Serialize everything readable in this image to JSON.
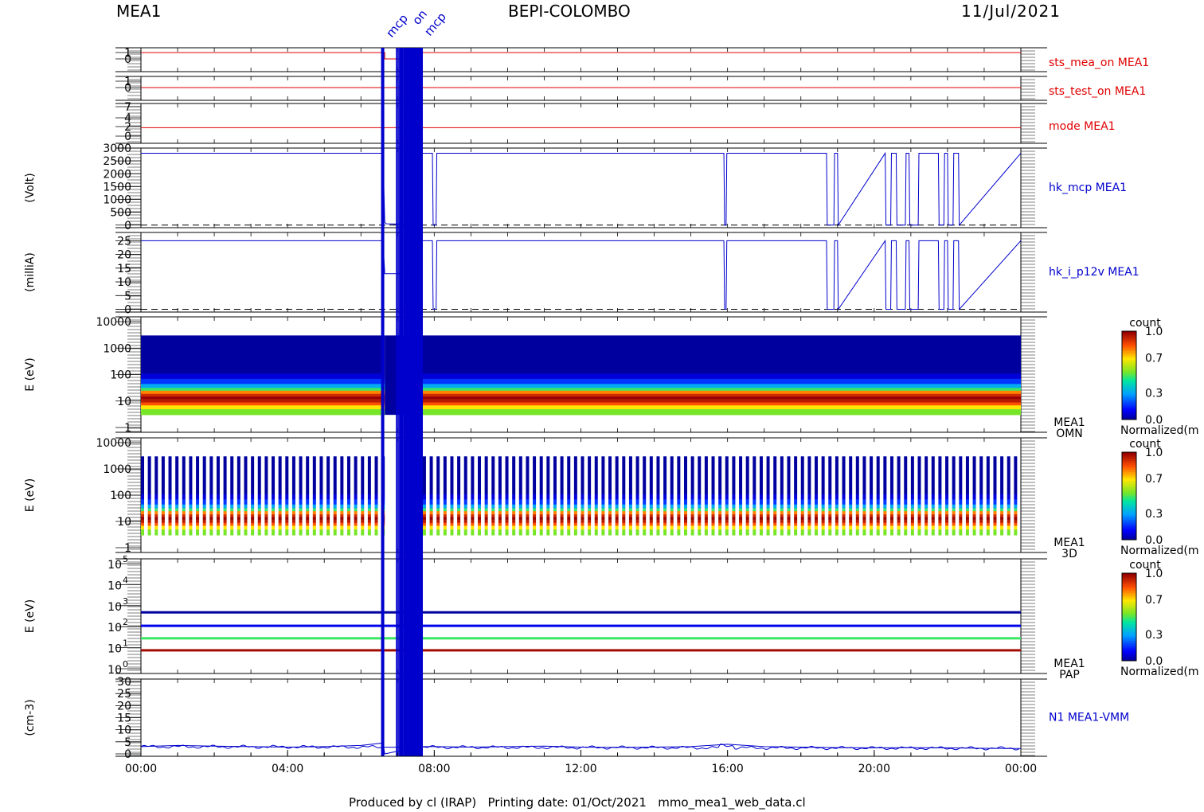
{
  "header": {
    "left": "MEA1",
    "center": "BEPI-COLOMBO",
    "right": "11/Jul/2021"
  },
  "footer": {
    "text": "Produced by cl (IRAP)   Printing date: 01/Oct/2021   mmo_mea1_web_data.cl"
  },
  "event_markers": {
    "labels": [
      "mcp",
      "on",
      "mcp"
    ],
    "color": "#0000cc"
  },
  "colors": {
    "red": "#e00000",
    "blue": "#0000cc",
    "black": "#000000"
  },
  "chart_data": [
    {
      "id": "sts_mea_on",
      "type": "line",
      "title": "sts_mea_on MEA1",
      "ylabel": "",
      "yticks": [
        "1",
        "0"
      ],
      "ylim": [
        0,
        1
      ],
      "color": "#e00000",
      "x_hours": [
        0,
        6.65,
        6.65,
        7.2,
        7.2,
        24
      ],
      "values": [
        1,
        1,
        0,
        0,
        1,
        1
      ]
    },
    {
      "id": "sts_test_on",
      "type": "line",
      "title": "sts_test_on MEA1",
      "ylabel": "",
      "yticks": [
        "1",
        "0"
      ],
      "ylim": [
        0,
        1
      ],
      "color": "#e00000",
      "x_hours": [
        0,
        24
      ],
      "values": [
        0,
        0
      ]
    },
    {
      "id": "mode",
      "type": "line",
      "title": "mode MEA1",
      "ylabel": "",
      "yticks": [
        "7",
        "4",
        "2",
        "0"
      ],
      "ylim": [
        0,
        7
      ],
      "color": "#e00000",
      "x_hours": [
        0,
        24
      ],
      "values": [
        2,
        2
      ]
    },
    {
      "id": "hk_mcp",
      "type": "line",
      "title": "hk_mcp MEA1",
      "ylabel": "(Volt)",
      "yticks": [
        "3000",
        "2500",
        "2000",
        "1500",
        "1000",
        "500",
        "0"
      ],
      "ylim": [
        -100,
        3000
      ],
      "color": "#0000cc",
      "baseline": 2800,
      "x_hours": [
        0,
        6.6,
        6.65,
        6.7,
        7.2,
        7.6,
        7.95,
        7.97,
        8.05,
        8.07,
        15.9,
        15.92,
        15.96,
        15.98,
        18.7,
        18.72,
        18.9,
        18.92,
        19.0,
        19.02,
        20.3,
        20.32,
        20.45,
        20.47,
        20.6,
        20.62,
        20.85,
        20.87,
        20.95,
        20.97,
        21.2,
        21.22,
        21.75,
        21.77,
        21.9,
        21.92,
        22.0,
        22.02,
        22.15,
        22.17,
        22.3,
        22.32,
        24
      ],
      "values": [
        2800,
        2800,
        100,
        50,
        30,
        2800,
        2800,
        0,
        0,
        2800,
        2800,
        0,
        0,
        2800,
        2800,
        0,
        0,
        2800,
        2800,
        0,
        2800,
        0,
        0,
        2800,
        2800,
        0,
        0,
        2800,
        2800,
        0,
        0,
        2800,
        2800,
        0,
        0,
        2800,
        2800,
        0,
        0,
        2800,
        2800,
        0,
        2800
      ]
    },
    {
      "id": "hk_i_p12v",
      "type": "line",
      "title": "hk_i_p12v MEA1",
      "ylabel": "(milliA)",
      "yticks": [
        "25",
        "20",
        "15",
        "10",
        "5",
        "0"
      ],
      "ylim": [
        -1,
        28
      ],
      "color": "#0000cc",
      "baseline": 25,
      "x_hours": [
        0,
        6.6,
        6.65,
        7.2,
        7.6,
        7.95,
        7.97,
        8.05,
        8.07,
        15.9,
        15.92,
        15.96,
        15.98,
        18.7,
        18.72,
        18.9,
        18.92,
        19.0,
        19.02,
        20.3,
        20.32,
        20.45,
        20.47,
        20.6,
        20.62,
        20.85,
        20.87,
        20.95,
        20.97,
        21.2,
        21.22,
        21.75,
        21.77,
        21.9,
        21.92,
        22.0,
        22.02,
        22.15,
        22.17,
        22.3,
        22.32,
        24
      ],
      "values": [
        25,
        25,
        13,
        13,
        25,
        25,
        0,
        0,
        25,
        25,
        0,
        0,
        25,
        25,
        0,
        0,
        25,
        25,
        0,
        25,
        0,
        0,
        25,
        25,
        0,
        0,
        25,
        25,
        0,
        0,
        25,
        25,
        0,
        0,
        25,
        25,
        0,
        0,
        25,
        25,
        0,
        25
      ]
    },
    {
      "id": "omn",
      "type": "heatmap",
      "title": "MEA1",
      "subtitle": "OMN",
      "ylabel": "E (eV)",
      "yscale": "log",
      "yticks": [
        "10000",
        "1000",
        "100",
        "10",
        "1"
      ],
      "ylim": [
        1,
        10000
      ],
      "data_erange": [
        3,
        3000
      ],
      "bands_eV": [
        3,
        5,
        7,
        9,
        12,
        15,
        19,
        25,
        32,
        45,
        70,
        110,
        3000
      ],
      "band_levels": [
        0.55,
        0.7,
        0.85,
        0.95,
        1.0,
        0.92,
        0.8,
        0.5,
        0.32,
        0.18,
        0.08,
        0.02
      ],
      "gap_hours": [
        [
          6.65,
          7.6
        ]
      ],
      "colorbar": {
        "label": "count",
        "ticks": [
          "1.0",
          "0.7",
          "0.3",
          "0.0"
        ],
        "caption": "Normalized(m"
      }
    },
    {
      "id": "3d",
      "type": "heatmap",
      "title": "MEA1",
      "subtitle": "3D",
      "ylabel": "E (eV)",
      "yscale": "log",
      "yticks": [
        "10000",
        "1000",
        "100",
        "10",
        "1"
      ],
      "ylim": [
        1,
        10000
      ],
      "data_erange": [
        3,
        3000
      ],
      "bands_eV": [
        3,
        5,
        7,
        9,
        12,
        15,
        19,
        25,
        32,
        45,
        70,
        110,
        3000
      ],
      "band_levels": [
        0.55,
        0.7,
        0.85,
        0.95,
        1.0,
        0.92,
        0.8,
        0.5,
        0.32,
        0.18,
        0.08,
        0.02
      ],
      "stripe_count": 128,
      "gap_hours": [
        [
          6.65,
          7.6
        ]
      ],
      "colorbar": {
        "label": "count",
        "ticks": [
          "1.0",
          "0.7",
          "0.3",
          "0.0"
        ],
        "caption": "Normalized(m"
      }
    },
    {
      "id": "pap",
      "type": "heatmap",
      "title": "MEA1",
      "subtitle": "PAP",
      "ylabel": "E (eV)",
      "yscale": "log",
      "yticks": [
        "10^5",
        "10^4",
        "10^3",
        "10^2",
        "10^1",
        "10^0"
      ],
      "ylim": [
        1,
        100000
      ],
      "lines_eV": [
        480,
        110,
        28,
        7.5
      ],
      "line_levels": [
        0.02,
        0.1,
        0.5,
        0.98
      ],
      "colorbar": {
        "label": "count",
        "ticks": [
          "1.0",
          "0.7",
          "0.3",
          "0.0"
        ],
        "caption": "Normalized(m"
      }
    },
    {
      "id": "n1",
      "type": "line",
      "title": "N1 MEA1-VMM",
      "ylabel": "(cm-3)",
      "yticks": [
        "30",
        "25",
        "20",
        "15",
        "10",
        "5",
        "0"
      ],
      "ylim": [
        -1,
        31
      ],
      "color": "#0000cc",
      "x_hours": [
        0,
        1,
        2,
        3,
        4,
        5,
        6,
        6.6,
        6.65,
        7.6,
        8,
        9,
        10,
        11,
        12,
        13,
        14,
        15,
        16,
        17,
        18,
        19,
        20,
        21,
        22,
        23,
        24
      ],
      "values": [
        3,
        3.5,
        3.2,
        3,
        2.8,
        3,
        3.5,
        4.5,
        0,
        3,
        3,
        2.8,
        3,
        3.2,
        2.8,
        2.7,
        2.8,
        3,
        4,
        3,
        2.8,
        2.6,
        2.5,
        2.6,
        2.5,
        2.3,
        2.2
      ]
    }
  ],
  "x_axis": {
    "ticks": [
      "00:00",
      "04:00",
      "08:00",
      "12:00",
      "16:00",
      "20:00",
      "00:00"
    ],
    "range_hours": [
      0,
      24
    ]
  }
}
